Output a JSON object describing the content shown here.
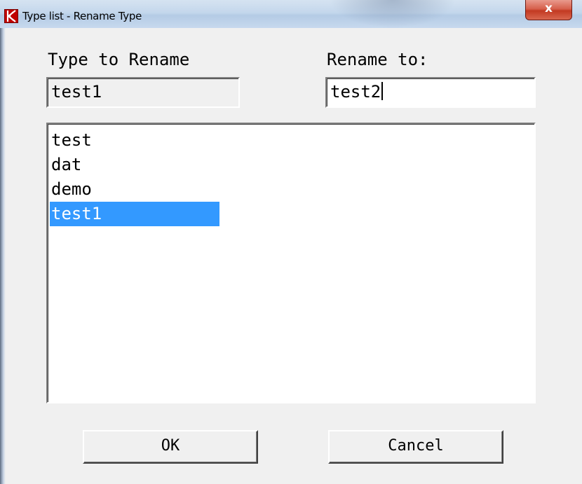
{
  "window": {
    "title": "Type list - Rename Type",
    "close_label": "x",
    "icon": "app-logo-icon"
  },
  "form": {
    "type_to_rename_label": "Type to Rename",
    "type_to_rename_value": "test1",
    "rename_to_label": "Rename to:",
    "rename_to_value": "test2"
  },
  "list": {
    "items": [
      "test",
      "dat",
      "demo",
      "test1"
    ],
    "selected_index": 3
  },
  "buttons": {
    "ok_label": "OK",
    "cancel_label": "Cancel"
  },
  "colors": {
    "selection": "#3399ff",
    "close_button": "#c23a22"
  }
}
